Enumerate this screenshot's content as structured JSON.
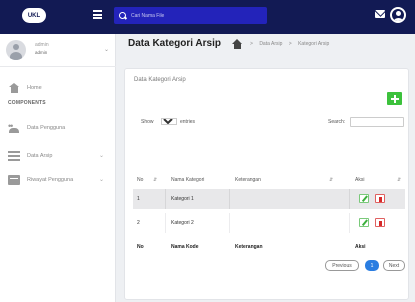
{
  "app": {
    "logo_text": "UKL",
    "search": {
      "placeholder": "Cari Nama File"
    }
  },
  "sidebar": {
    "user": {
      "name": "admin",
      "role": "admin"
    },
    "items": [
      {
        "label": "Home"
      },
      {
        "label": "Data Pengguna"
      },
      {
        "label": "Data Arsip"
      },
      {
        "label": "Riwayat Pengguna"
      }
    ],
    "section_label": "COMPONENTS"
  },
  "header": {
    "title": "Data Kategori Arsip",
    "breadcrumb": [
      ">",
      "Data Arsip",
      ">",
      "Kategori Arsip"
    ]
  },
  "card": {
    "title": "Data Kategori Arsip",
    "show_label": "Show",
    "entries_value": "10",
    "entries_label": "entries",
    "search_label": "Search:"
  },
  "table": {
    "headers": {
      "no": "No",
      "name": "Nama Kategori",
      "keterangan": "Keterangan",
      "aksi": "Aksi"
    },
    "sort_glyph": "⇵",
    "rows": [
      {
        "no": "1",
        "name": "Kategori 1",
        "keterangan": ""
      },
      {
        "no": "2",
        "name": "Kategori 2",
        "keterangan": ""
      }
    ],
    "footer": {
      "no": "No",
      "name": "Nama Kode",
      "keterangan": "Keterangan",
      "aksi": "Aksi"
    }
  },
  "pagination": {
    "previous": "Previous",
    "current": "1",
    "next": "Next"
  },
  "colors": {
    "topbar": "#121a54",
    "search_bg": "#2323ba",
    "add_button": "#3cc13c",
    "delete": "#d62a2a",
    "page_active": "#2a7de1"
  }
}
